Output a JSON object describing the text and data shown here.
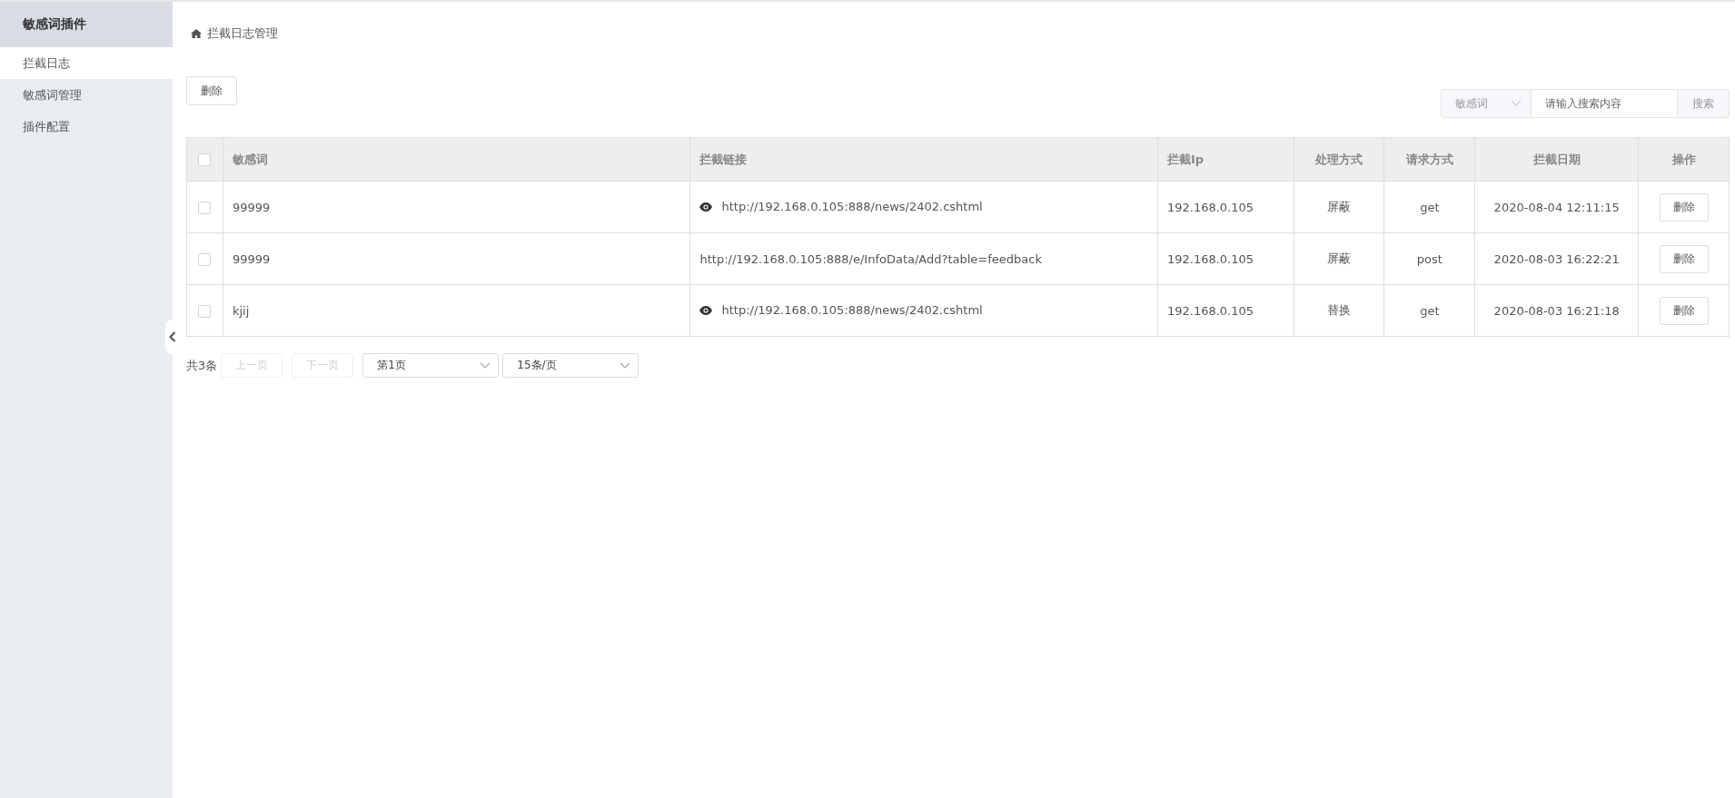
{
  "sidebar": {
    "title": "敏感词插件",
    "items": [
      {
        "label": "拦截日志",
        "selected": true
      },
      {
        "label": "敏感词管理",
        "selected": false
      },
      {
        "label": "插件配置",
        "selected": false
      }
    ]
  },
  "breadcrumb": "拦截日志管理",
  "toolbar": {
    "delete_button": "删除",
    "search": {
      "filter": "敏感词",
      "placeholder": "请输入搜索内容",
      "button": "搜索"
    }
  },
  "table": {
    "columns": [
      "敏感词",
      "拦截链接",
      "拦截Ip",
      "处理方式",
      "请求方式",
      "拦截日期",
      "操作"
    ],
    "header_checked": false,
    "rows": [
      {
        "checked": false,
        "word": "99999",
        "link": "http://192.168.0.105:888/news/2402.cshtml",
        "preview": true,
        "ip": "192.168.0.105",
        "handling": "屏蔽",
        "method": "get",
        "date": "2020-08-04 12:11:15",
        "action": "删除"
      },
      {
        "checked": false,
        "word": "99999",
        "link": "http://192.168.0.105:888/e/InfoData/Add?table=feedback",
        "preview": false,
        "ip": "192.168.0.105",
        "handling": "屏蔽",
        "method": "post",
        "date": "2020-08-03 16:22:21",
        "action": "删除"
      },
      {
        "checked": false,
        "word": "kjij",
        "link": "http://192.168.0.105:888/news/2402.cshtml",
        "preview": true,
        "ip": "192.168.0.105",
        "handling": "替换",
        "method": "get",
        "date": "2020-08-03 16:21:18",
        "action": "删除"
      }
    ]
  },
  "pagination": {
    "total": "共3条",
    "prev": {
      "label": "上一页",
      "disabled": true
    },
    "next": {
      "label": "下一页",
      "disabled": true
    },
    "page": "第1页",
    "page_size": "15条/页"
  }
}
